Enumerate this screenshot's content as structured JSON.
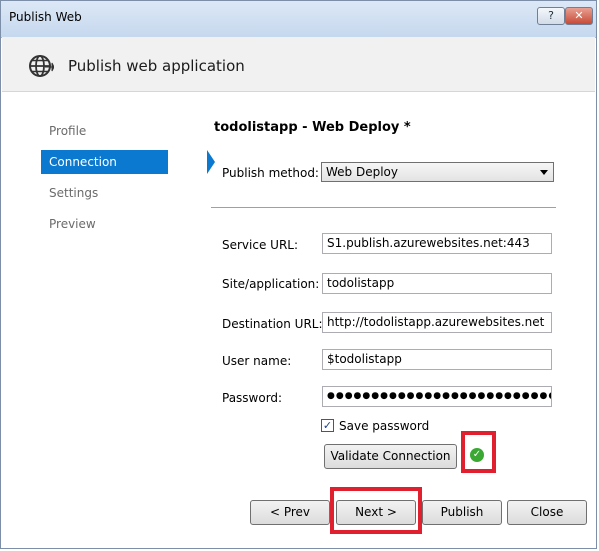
{
  "window": {
    "title": "Publish Web",
    "help_label": "?",
    "close_label": "✕"
  },
  "header": {
    "title": "Publish web application",
    "icon": "globe-publish-icon"
  },
  "nav": {
    "items": [
      {
        "label": "Profile",
        "active": false
      },
      {
        "label": "Connection",
        "active": true
      },
      {
        "label": "Settings",
        "active": false
      },
      {
        "label": "Preview",
        "active": false
      }
    ]
  },
  "main": {
    "profile_title": "todolistapp - Web Deploy *",
    "publish_method": {
      "label": "Publish method:",
      "value": "Web Deploy"
    },
    "fields": {
      "service_url": {
        "label": "Service URL:",
        "value": "S1.publish.azurewebsites.net:443"
      },
      "site_application": {
        "label": "Site/application:",
        "value": "todolistapp"
      },
      "destination_url": {
        "label": "Destination URL:",
        "value": "http://todolistapp.azurewebsites.net"
      },
      "user_name": {
        "label": "User name:",
        "value": "$todolistapp"
      },
      "password": {
        "label": "Password:",
        "value": "●●●●●●●●●●●●●●●●●●●●●●●●●●●●●●●●●●●●●●●●●"
      }
    },
    "save_password": {
      "label": "Save password",
      "checked": true,
      "check_mark": "✓"
    },
    "validate_button": "Validate Connection",
    "validation_status": {
      "icon": "checkmark-icon",
      "glyph": "✓",
      "color": "#3aa833"
    }
  },
  "footer": {
    "prev": "< Prev",
    "next": "Next >",
    "publish": "Publish",
    "close": "Close"
  },
  "highlight_color": "#e0202e"
}
